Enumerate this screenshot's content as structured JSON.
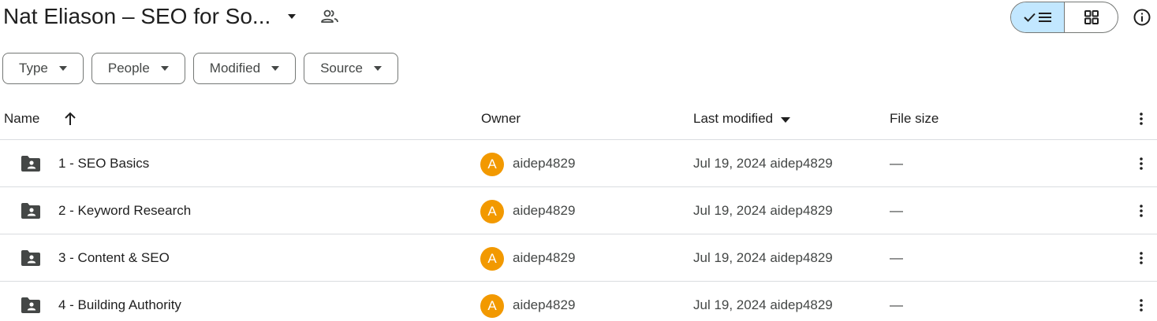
{
  "header": {
    "title": "Nat Eliason – SEO for So...",
    "view_toggle": {
      "list_icon": "check-list-icon",
      "grid_icon": "grid-icon",
      "active": "list"
    },
    "info_icon": "info-icon"
  },
  "filters": [
    {
      "label": "Type"
    },
    {
      "label": "People"
    },
    {
      "label": "Modified"
    },
    {
      "label": "Source"
    }
  ],
  "columns": {
    "name": "Name",
    "owner": "Owner",
    "last_modified": "Last modified",
    "file_size": "File size"
  },
  "rows": [
    {
      "name": "1 - SEO Basics",
      "owner_initial": "A",
      "owner": "aidep4829",
      "modified": "Jul 19, 2024 aidep4829",
      "size": "—"
    },
    {
      "name": "2 - Keyword Research",
      "owner_initial": "A",
      "owner": "aidep4829",
      "modified": "Jul 19, 2024 aidep4829",
      "size": "—"
    },
    {
      "name": "3 - Content & SEO",
      "owner_initial": "A",
      "owner": "aidep4829",
      "modified": "Jul 19, 2024 aidep4829",
      "size": "—"
    },
    {
      "name": "4 - Building Authority",
      "owner_initial": "A",
      "owner": "aidep4829",
      "modified": "Jul 19, 2024 aidep4829",
      "size": "—"
    }
  ],
  "colors": {
    "accent": "#c2e7ff",
    "avatar": "#f29900",
    "divider": "#dadce0",
    "outline": "#747775"
  }
}
